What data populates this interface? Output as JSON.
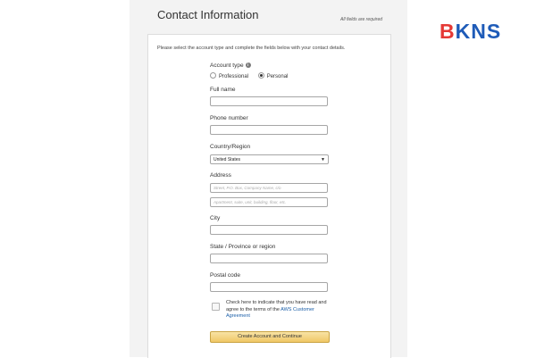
{
  "window": {
    "title": "Contact Information",
    "required_note": "All fields are required"
  },
  "form": {
    "intro": "Please select the account type and complete the fields below with your contact details.",
    "account_type": {
      "label": "Account type",
      "options": [
        "Professional",
        "Personal"
      ],
      "selected": "Personal"
    },
    "full_name": {
      "label": "Full name",
      "value": ""
    },
    "phone": {
      "label": "Phone number",
      "value": ""
    },
    "country": {
      "label": "Country/Region",
      "value": "United States"
    },
    "address": {
      "label": "Address",
      "line1_placeholder": "Street, P.O. Box, Company Name, c/o",
      "line2_placeholder": "Apartment, suite, unit, building, floor, etc."
    },
    "city": {
      "label": "City",
      "value": ""
    },
    "state": {
      "label": "State / Province or region",
      "value": ""
    },
    "postal": {
      "label": "Postal code",
      "value": ""
    },
    "agreement": {
      "text": "Check here to indicate that you have read and agree to the terms of the ",
      "link": "AWS Customer Agreement",
      "checked": false
    },
    "submit_label": "Create Account and Continue"
  },
  "logo": {
    "part1": "B",
    "part2": "KNS"
  },
  "colors": {
    "logo_red": "#e53935",
    "logo_blue": "#1e5bb8",
    "button_gold": "#f0c766",
    "link": "#1a5ea8"
  }
}
